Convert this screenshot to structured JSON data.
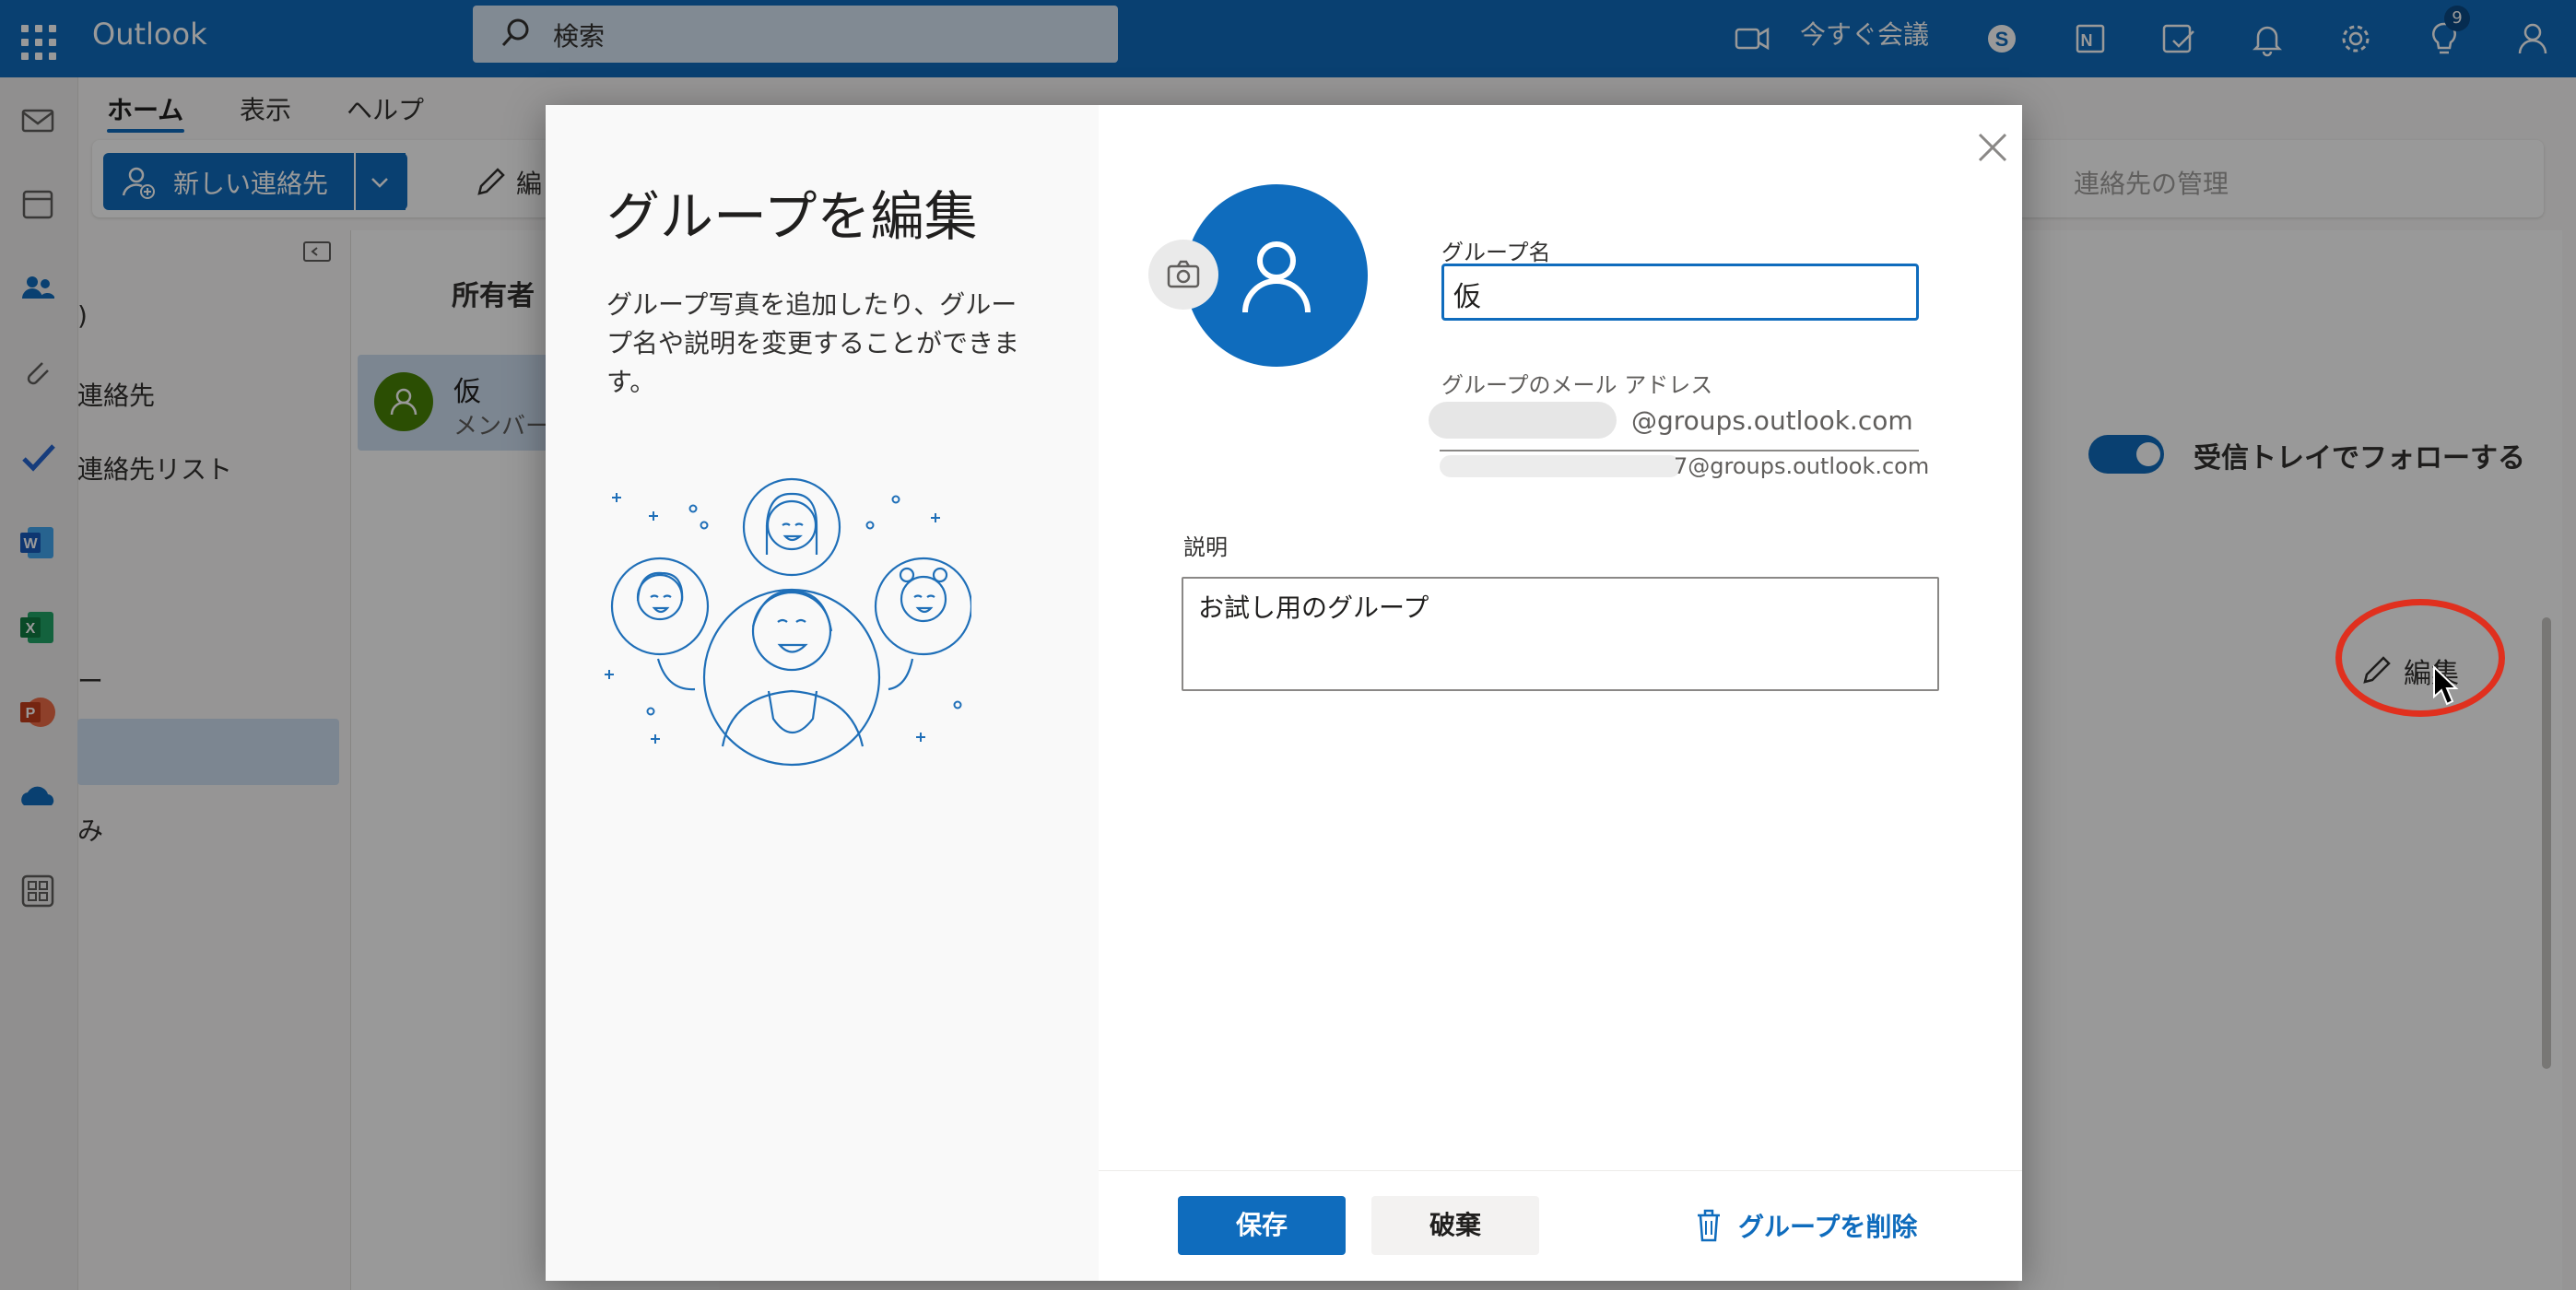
{
  "app": {
    "name": "Outlook"
  },
  "topbar": {
    "search_placeholder": "検索",
    "meet_now": "今すぐ会議",
    "notifications_badge": "9",
    "icons": [
      "waffle-icon",
      "search-icon",
      "video-icon",
      "skype-icon",
      "onenote-icon",
      "calendar-check-icon",
      "bell-icon",
      "gear-icon",
      "lightbulb-icon",
      "person-icon"
    ]
  },
  "ribbon": {
    "tabs": [
      {
        "label": "ホーム",
        "selected": true
      },
      {
        "label": "表示",
        "selected": false
      },
      {
        "label": "ヘルプ",
        "selected": false
      }
    ],
    "new_contact": "新しい連絡先",
    "edit_partial": "編",
    "manage_contacts": "連絡先の管理"
  },
  "nav": {
    "items": [
      ")",
      "連絡先",
      "連絡先リスト",
      "ー",
      "み"
    ]
  },
  "list": {
    "header": "所有者",
    "row": {
      "name": "仮",
      "sub": "メンバー"
    }
  },
  "details": {
    "follow_label": "受信トレイでフォローする",
    "edit_label": "編集"
  },
  "dialog": {
    "title": "グループを編集",
    "description": "グループ写真を追加したり、グループ名や説明を変更することができます。",
    "group_name_label": "グループ名",
    "group_name_value": "仮",
    "email_label": "グループのメール アドレス",
    "email_domain": "@groups.outlook.com",
    "email_domain_alt": "7@groups.outlook.com",
    "description_label": "説明",
    "description_value": "お試し用のグループ",
    "save": "保存",
    "discard": "破棄",
    "delete_group": "グループを削除"
  },
  "colors": {
    "accent": "#0f6cbd",
    "annotation": "#e0301e",
    "avatar_green": "#498205"
  }
}
